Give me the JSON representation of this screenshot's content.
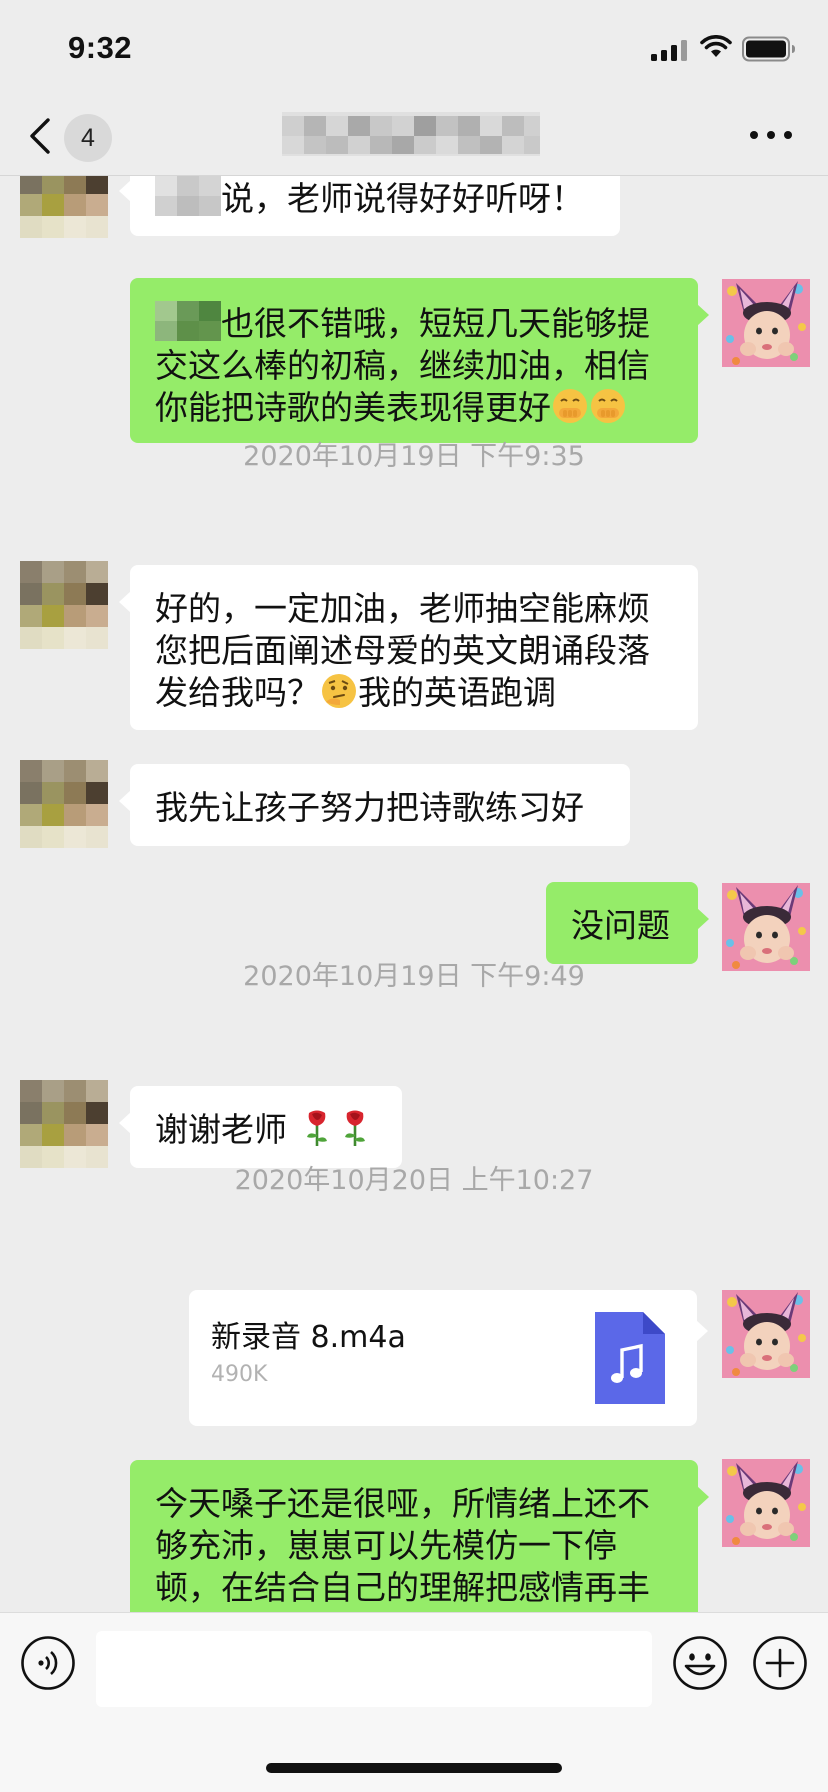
{
  "status_bar": {
    "time": "9:32",
    "icons": [
      "signal-icon",
      "wifi-icon",
      "battery-icon"
    ]
  },
  "nav": {
    "back_icon": "chevron-left-icon",
    "unread_count": "4",
    "title_redacted": true,
    "more_icon": "more-dots-icon"
  },
  "messages": [
    {
      "type": "text",
      "side": "left",
      "redacted_prefix": true,
      "text": "说，老师说得好好听呀！"
    },
    {
      "type": "text",
      "side": "right",
      "redacted_prefix": true,
      "lines": [
        "也很不错哦，短短几天能够提",
        "交这么棒的初稿，继续加油，相信",
        "你能把诗歌的美表现得更好"
      ],
      "emoji": [
        "shushing-face-emoji",
        "shushing-face-emoji"
      ]
    },
    {
      "type": "timestamp",
      "text": "2020年10月19日 下午9:35"
    },
    {
      "type": "text",
      "side": "left",
      "lines": [
        "好的，一定加油，老师抽空能麻烦",
        "您把后面阐述母爱的英文朗诵段落",
        "发给我吗？",
        "我的英语跑调"
      ],
      "emoji": [
        "thinking-face-emoji"
      ]
    },
    {
      "type": "text",
      "side": "left",
      "text": "我先让孩子努力把诗歌练习好"
    },
    {
      "type": "text",
      "side": "right",
      "text": "没问题"
    },
    {
      "type": "timestamp",
      "text": "2020年10月19日 下午9:49"
    },
    {
      "type": "text",
      "side": "left",
      "text": "谢谢老师",
      "emoji": [
        "rose-emoji",
        "rose-emoji"
      ]
    },
    {
      "type": "timestamp",
      "text": "2020年10月20日 上午10:27"
    },
    {
      "type": "file",
      "side": "right",
      "name": "新录音 8.m4a",
      "size": "490K",
      "icon": "music-file-icon"
    },
    {
      "type": "text",
      "side": "right",
      "lines": [
        "今天嗓子还是很哑，所情绪上还不",
        "够充沛，崽崽可以先模仿一下停",
        "顿，在结合自己的理解把感情再丰"
      ]
    }
  ],
  "input_bar": {
    "voice_icon": "voice-icon",
    "input_value": "",
    "emoji_icon": "emoji-icon",
    "plus_icon": "plus-icon"
  },
  "colors": {
    "background": "#ededed",
    "green_bubble": "#95ec69",
    "white_bubble": "#ffffff",
    "timestamp": "#a8a8a8",
    "file_icon": "#5b68e8"
  }
}
